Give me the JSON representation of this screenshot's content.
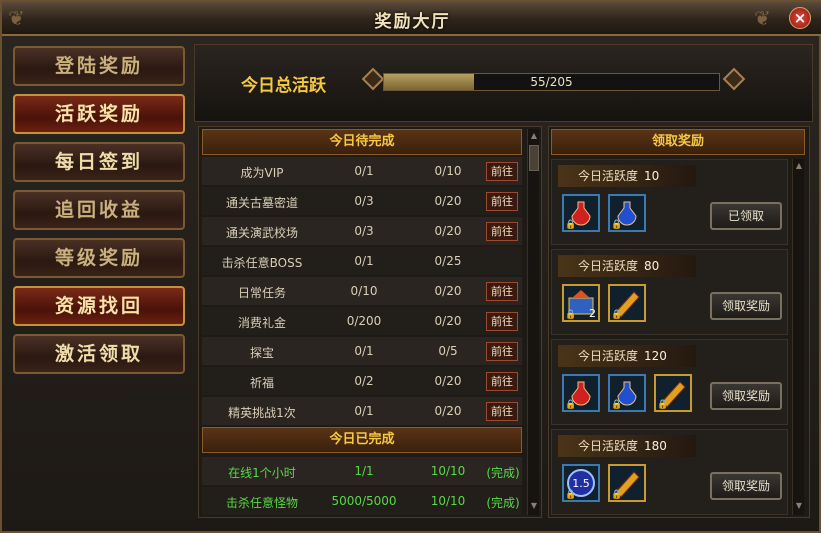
{
  "window": {
    "title": "奖励大厅",
    "close": "×"
  },
  "sidebar": {
    "items": [
      {
        "label": "登陆奖励"
      },
      {
        "label": "活跃奖励"
      },
      {
        "label": "每日签到"
      },
      {
        "label": "追回收益"
      },
      {
        "label": "等级奖励"
      },
      {
        "label": "资源找回"
      },
      {
        "label": "激活领取"
      }
    ]
  },
  "activity": {
    "label": "今日总活跃",
    "current": 55,
    "max": 205,
    "text": "55/205"
  },
  "pending": {
    "title": "今日待完成",
    "rows": [
      {
        "name": "成为VIP",
        "progress": "0/1",
        "points": "0/10",
        "action": "前往"
      },
      {
        "name": "通关古墓密道",
        "progress": "0/3",
        "points": "0/20",
        "action": "前往"
      },
      {
        "name": "通关演武校场",
        "progress": "0/3",
        "points": "0/20",
        "action": "前往"
      },
      {
        "name": "击杀任意BOSS",
        "progress": "0/1",
        "points": "0/25",
        "action": ""
      },
      {
        "name": "日常任务",
        "progress": "0/10",
        "points": "0/20",
        "action": "前往"
      },
      {
        "name": "消费礼金",
        "progress": "0/200",
        "points": "0/20",
        "action": "前往"
      },
      {
        "name": "探宝",
        "progress": "0/1",
        "points": "0/5",
        "action": "前往"
      },
      {
        "name": "祈福",
        "progress": "0/2",
        "points": "0/20",
        "action": "前往"
      },
      {
        "name": "精英挑战1次",
        "progress": "0/1",
        "points": "0/20",
        "action": "前往"
      }
    ]
  },
  "completed": {
    "title": "今日已完成",
    "rows": [
      {
        "name": "在线1个小时",
        "progress": "1/1",
        "points": "10/10",
        "status": "(完成)"
      },
      {
        "name": "击杀任意怪物",
        "progress": "5000/5000",
        "points": "10/10",
        "status": "(完成)"
      }
    ]
  },
  "rewards": {
    "title": "领取奖励",
    "tier_label": "今日活跃度",
    "tiers": [
      {
        "value": "10",
        "button": "已领取",
        "items": [
          {
            "icon": "red-potion-icon"
          },
          {
            "icon": "blue-potion-icon"
          }
        ]
      },
      {
        "value": "80",
        "button": "领取奖励",
        "items": [
          {
            "icon": "treasure-chest-icon",
            "qty": "2"
          },
          {
            "icon": "gold-scroll-icon"
          }
        ]
      },
      {
        "value": "120",
        "button": "领取奖励",
        "items": [
          {
            "icon": "red-potion-icon"
          },
          {
            "icon": "blue-potion-icon"
          },
          {
            "icon": "gold-scroll-icon"
          }
        ]
      },
      {
        "value": "180",
        "button": "领取奖励",
        "items": [
          {
            "icon": "exp-orb-icon",
            "label": "1.5"
          },
          {
            "icon": "gold-scroll-icon"
          }
        ]
      }
    ]
  }
}
